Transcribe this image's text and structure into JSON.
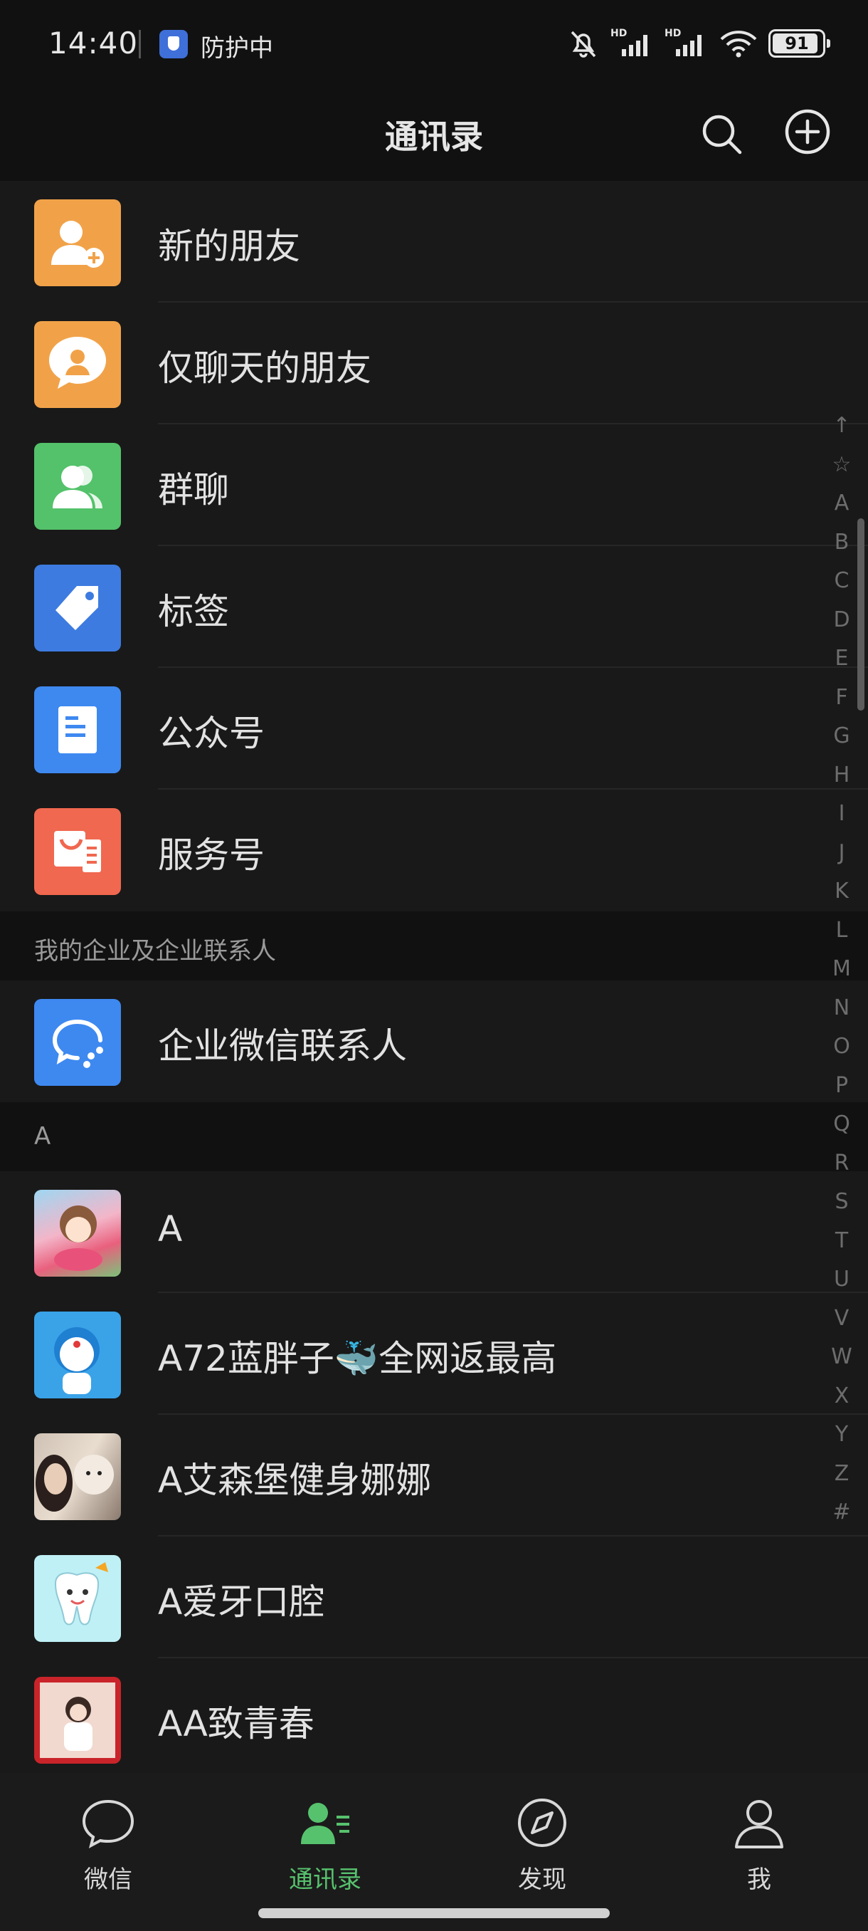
{
  "status_bar": {
    "time": "14:40",
    "protect": "防护中",
    "battery": "91",
    "icons": [
      "mute-bell-icon",
      "hd-signal-icon",
      "hd-signal-icon",
      "wifi-icon",
      "battery-icon"
    ]
  },
  "nav": {
    "title": "通讯录",
    "search_icon": "search-icon",
    "add_icon": "add-circle-icon"
  },
  "functions": [
    {
      "label": "新的朋友",
      "icon": "new-friend-icon",
      "color": "#f1a249"
    },
    {
      "label": "仅聊天的朋友",
      "icon": "chat-only-friend-icon",
      "color": "#f1a249"
    },
    {
      "label": "群聊",
      "icon": "group-chat-icon",
      "color": "#53c26a"
    },
    {
      "label": "标签",
      "icon": "tag-icon",
      "color": "#3d7be0"
    },
    {
      "label": "公众号",
      "icon": "official-account-icon",
      "color": "#3e89f0"
    },
    {
      "label": "服务号",
      "icon": "service-account-icon",
      "color": "#f0684f"
    }
  ],
  "enterprise_section": {
    "title": "我的企业及企业联系人",
    "item": "企业微信联系人"
  },
  "contacts_section": {
    "letter": "A",
    "contacts": [
      {
        "name": "A"
      },
      {
        "name": "A72蓝胖子🐳全网返最高"
      },
      {
        "name": "A艾森堡健身娜娜"
      },
      {
        "name": "A爱牙口腔"
      },
      {
        "name": "AA致青春"
      }
    ]
  },
  "index_letters": [
    "↑",
    "☆",
    "A",
    "B",
    "C",
    "D",
    "E",
    "F",
    "G",
    "H",
    "I",
    "J",
    "K",
    "L",
    "M",
    "N",
    "O",
    "P",
    "Q",
    "R",
    "S",
    "T",
    "U",
    "V",
    "W",
    "X",
    "Y",
    "Z",
    "#"
  ],
  "tabs": [
    {
      "label": "微信",
      "icon": "chat-bubble-icon",
      "active": false
    },
    {
      "label": "通讯录",
      "icon": "contacts-icon",
      "active": true
    },
    {
      "label": "发现",
      "icon": "compass-icon",
      "active": false
    },
    {
      "label": "我",
      "icon": "person-icon",
      "active": false
    }
  ],
  "colors": {
    "accent": "#57c26e",
    "background": "#191919"
  }
}
